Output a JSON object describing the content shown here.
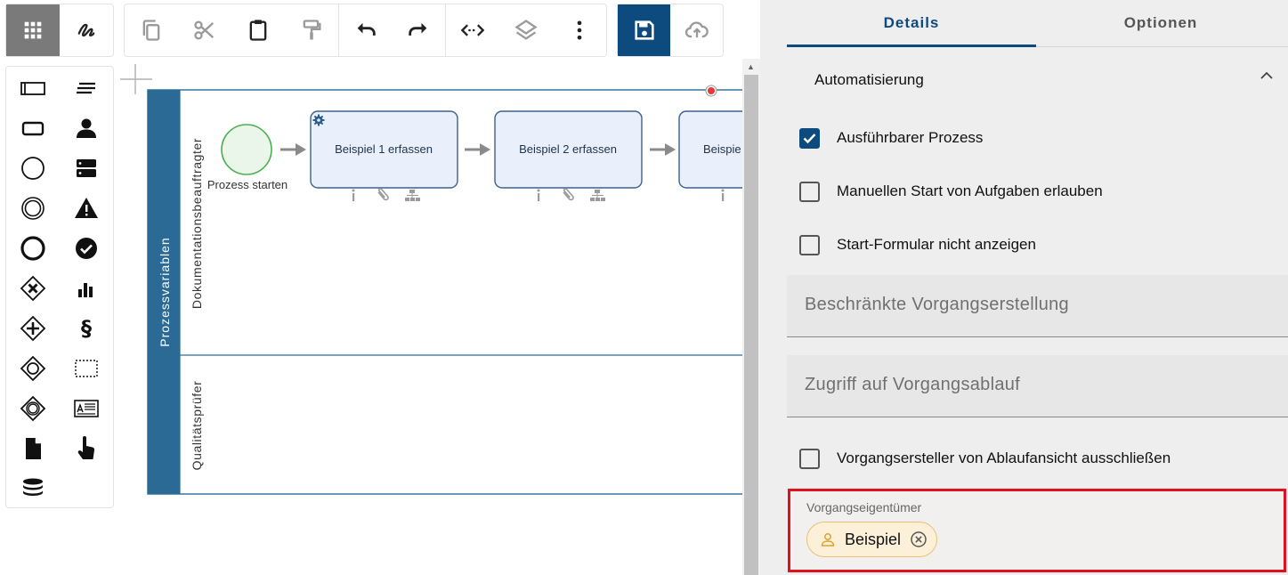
{
  "toolbar": {
    "mode_buttons": [
      {
        "name": "palette-grid",
        "icon": "grid-icon",
        "active": true
      },
      {
        "name": "freehand",
        "icon": "freehand-icon",
        "active": false
      }
    ],
    "edit_buttons": [
      {
        "name": "copy",
        "icon": "copy-icon",
        "disabled": true
      },
      {
        "name": "cut",
        "icon": "scissors-icon",
        "disabled": true
      },
      {
        "name": "paste",
        "icon": "clipboard-icon",
        "disabled": false
      },
      {
        "name": "format-painter",
        "icon": "paint-roller-icon",
        "disabled": true
      }
    ],
    "history_buttons": [
      {
        "name": "undo",
        "icon": "undo-icon"
      },
      {
        "name": "redo",
        "icon": "redo-icon"
      }
    ],
    "tool_buttons": [
      {
        "name": "connect",
        "icon": "code-arrows-icon"
      },
      {
        "name": "layers",
        "icon": "layers-icon"
      },
      {
        "name": "more",
        "icon": "more-vertical-icon"
      }
    ],
    "file_buttons": [
      {
        "name": "save",
        "icon": "save-icon",
        "primary": true
      },
      {
        "name": "upload",
        "icon": "cloud-upload-icon",
        "primary": false
      }
    ]
  },
  "palette": {
    "items": [
      {
        "name": "pool",
        "icon": "pool-icon"
      },
      {
        "name": "text-annotation",
        "icon": "text-lines-icon"
      },
      {
        "name": "task",
        "icon": "task-rectangle-icon"
      },
      {
        "name": "user",
        "icon": "person-icon"
      },
      {
        "name": "start-event",
        "icon": "circle-thin-icon"
      },
      {
        "name": "server",
        "icon": "server-icon"
      },
      {
        "name": "intermediate-event",
        "icon": "double-circle-icon"
      },
      {
        "name": "warning",
        "icon": "warning-icon"
      },
      {
        "name": "end-event",
        "icon": "circle-thick-icon"
      },
      {
        "name": "check",
        "icon": "check-circle-icon"
      },
      {
        "name": "exclusive-gateway",
        "icon": "gateway-x-icon"
      },
      {
        "name": "chart",
        "icon": "bar-chart-icon"
      },
      {
        "name": "parallel-gateway",
        "icon": "gateway-plus-icon"
      },
      {
        "name": "paragraph",
        "icon": "section-icon"
      },
      {
        "name": "inclusive-gateway",
        "icon": "gateway-circle-icon"
      },
      {
        "name": "group",
        "icon": "dashed-rect-icon"
      },
      {
        "name": "event-gateway",
        "icon": "gateway-event-icon"
      },
      {
        "name": "form",
        "icon": "form-icon"
      },
      {
        "name": "document",
        "icon": "document-icon"
      },
      {
        "name": "touch",
        "icon": "touch-icon"
      },
      {
        "name": "data-store",
        "icon": "database-icon"
      }
    ],
    "section_symbol": "§"
  },
  "diagram": {
    "pool_label": "Prozessvariablen",
    "lanes": [
      {
        "label": "Dokumentationsbeauftragter"
      },
      {
        "label": "Qualitätsprüfer"
      }
    ],
    "start_event_label": "Prozess starten",
    "tasks": [
      {
        "label": "Beispiel 1 erfassen",
        "service": true
      },
      {
        "label": "Beispiel 2 erfassen",
        "service": false
      },
      {
        "label": "Beispie",
        "service": false
      }
    ],
    "task_badges": [
      "info-icon",
      "paperclip-icon",
      "hierarchy-icon"
    ],
    "colors": {
      "pool": "#2c6a96",
      "task_fill": "#e9f0fb",
      "task_border": "#3d6189",
      "start_fill": "#eaf6ea",
      "start_border": "#4caf50"
    }
  },
  "panel": {
    "tabs": [
      {
        "label": "Details",
        "active": true
      },
      {
        "label": "Optionen",
        "active": false
      }
    ],
    "section_title": "Automatisierung",
    "checkboxes": [
      {
        "label": "Ausführbarer Prozess",
        "checked": true
      },
      {
        "label": "Manuellen Start von Aufgaben erlauben",
        "checked": false
      },
      {
        "label": "Start-Formular nicht anzeigen",
        "checked": false
      }
    ],
    "fields": [
      {
        "placeholder": "Beschränkte Vorgangserstellung"
      },
      {
        "placeholder": "Zugriff auf Vorgangsablauf"
      }
    ],
    "exclude_checkbox": {
      "label": "Vorgangsersteller von Ablaufansicht ausschließen",
      "checked": false
    },
    "owner": {
      "label": "Vorgangseigentümer",
      "chip": "Beispiel"
    },
    "colors": {
      "accent": "#0d4a7e",
      "highlight": "#e0101c",
      "chip_bg": "#fdf0d8"
    }
  }
}
